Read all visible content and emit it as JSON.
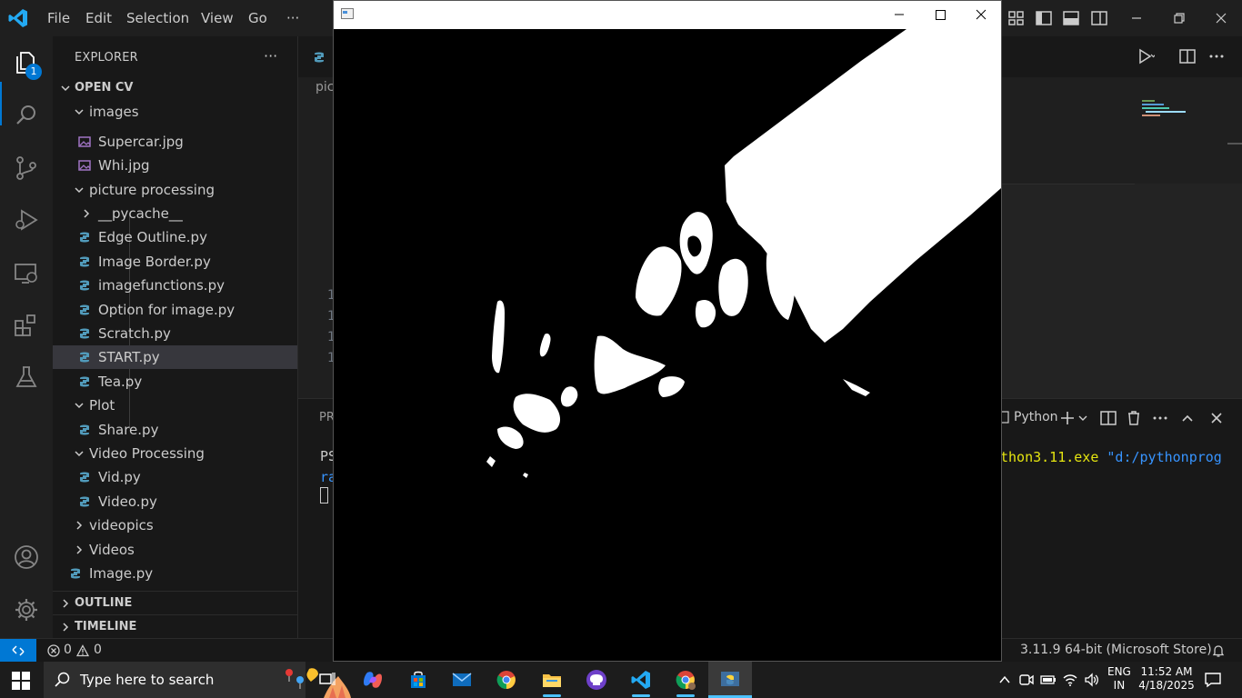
{
  "titlebar": {
    "menu": [
      "File",
      "Edit",
      "Selection",
      "View",
      "Go",
      "···"
    ]
  },
  "activity": {
    "explorer_badge": "1"
  },
  "sidebar": {
    "title": "EXPLORER",
    "more": "···",
    "folder": "OPEN CV",
    "tree": [
      {
        "label": "images",
        "kind": "folder-open"
      },
      {
        "label": "Supercar.jpg",
        "kind": "image"
      },
      {
        "label": "Whi.jpg",
        "kind": "image"
      },
      {
        "label": "picture processing",
        "kind": "folder-open"
      },
      {
        "label": "__pycache__",
        "kind": "folder-closed"
      },
      {
        "label": "Edge Outline.py",
        "kind": "python"
      },
      {
        "label": "Image Border.py",
        "kind": "python"
      },
      {
        "label": "imagefunctions.py",
        "kind": "python"
      },
      {
        "label": "Option for image.py",
        "kind": "python"
      },
      {
        "label": "Scratch.py",
        "kind": "python"
      },
      {
        "label": "START.py",
        "kind": "python",
        "selected": true
      },
      {
        "label": "Tea.py",
        "kind": "python"
      },
      {
        "label": "Plot",
        "kind": "folder-open"
      },
      {
        "label": "Share.py",
        "kind": "python"
      },
      {
        "label": "Video Processing",
        "kind": "folder-open"
      },
      {
        "label": "Vid.py",
        "kind": "python"
      },
      {
        "label": "Video.py",
        "kind": "python"
      },
      {
        "label": "videopics",
        "kind": "folder-closed"
      },
      {
        "label": "Videos",
        "kind": "folder-closed"
      },
      {
        "label": "Image.py",
        "kind": "python"
      }
    ],
    "sections": {
      "outline": "OUTLINE",
      "timeline": "TIMELINE"
    }
  },
  "editor": {
    "breadcrumb": "pic",
    "line_numbers": [
      "1",
      "1",
      "1",
      "1"
    ]
  },
  "panel": {
    "tab_partial": "PR",
    "shell": "Python",
    "terminal": {
      "line1": "PS",
      "line2": "ra",
      "cmd_exe": "thon3.11.exe",
      "cmd_arg": "\"d:/pythonprog"
    }
  },
  "statusbar": {
    "errors": "0",
    "warnings": "0",
    "interpreter": "3.11.9 64-bit (Microsoft Store)"
  },
  "taskbar": {
    "search_placeholder": "Type here to search",
    "lang_line1": "ENG",
    "lang_line2": "IN",
    "time": "11:52 AM",
    "date": "4/18/2025"
  },
  "colors": {
    "accent": "#0078d4",
    "python_icon": "#519aba",
    "image_icon": "#a074c4",
    "taskbar_indicator": "#4cc2ff"
  }
}
